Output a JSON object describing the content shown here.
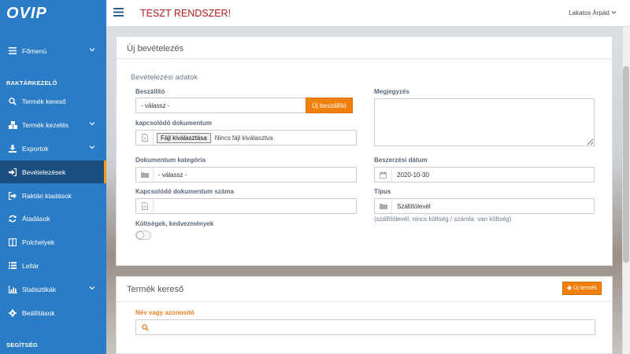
{
  "brand": {
    "logo_text": "OVIP"
  },
  "header": {
    "env_title": "TESZT RENDSZER!",
    "user_name": "Lakatos Árpád"
  },
  "sidebar": {
    "main_item": "Főmenü",
    "section_warehouse": "RAKTÁRKEZELŐ",
    "items": [
      {
        "label": "Termék kereső"
      },
      {
        "label": "Termék kezelés"
      },
      {
        "label": "Exportok"
      },
      {
        "label": "Bevételezések"
      },
      {
        "label": "Raktári kiadások"
      },
      {
        "label": "Átadások"
      },
      {
        "label": "Polchelyek"
      },
      {
        "label": "Leltár"
      },
      {
        "label": "Statisztikák"
      },
      {
        "label": "Beállítások"
      }
    ],
    "section_help": "SEGÍTSÉG"
  },
  "receipt": {
    "title": "Új bevételezés",
    "subheading": "Bevételezési adatok",
    "supplier_label": "Beszállító",
    "supplier_value": "- válassz -",
    "new_supplier_button": "Új beszállító",
    "doc_label": "kapcsolódó dokumentum",
    "file_button": "Fájl kiválasztása",
    "file_status": "Nincs fájl kiválasztva",
    "doc_category_label": "Dokumentum kategória",
    "doc_category_value": "- válassz -",
    "doc_number_label": "Kapcsolódó dokumentum száma",
    "costs_label": "Költségek, kedvezmények",
    "note_label": "Megjegyzés",
    "date_label": "Beszerzési dátum",
    "date_value": "2020-10-30",
    "type_label": "Típus",
    "type_value": "Szállítólevél",
    "type_hint": "(szállítólevél: nincs költség / számla: van költség)"
  },
  "product_search": {
    "title": "Termék kereső",
    "new_product_button": "Új termék",
    "name_label": "Név vagy azonosító"
  }
}
